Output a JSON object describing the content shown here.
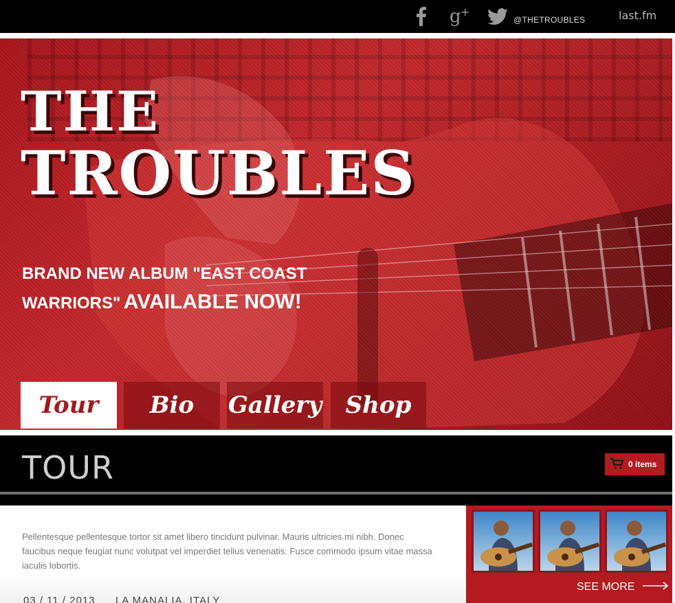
{
  "topbar": {
    "facebook_icon": "facebook-icon",
    "googleplus_icon": "google-plus-icon",
    "twitter_icon": "twitter-icon",
    "twitter_handle": "@THETROUBLES",
    "lastfm_label": "last.fm"
  },
  "hero": {
    "title_line1": "THE",
    "title_line2": "TROUBLES",
    "subtitle_part1": "BRAND NEW ALBUM \"EAST COAST",
    "subtitle_part2": "WARRIORS\"",
    "subtitle_part3": "AVAILABLE NOW!"
  },
  "nav": {
    "tabs": [
      {
        "label": "Tour",
        "active": true
      },
      {
        "label": "Bio",
        "active": false
      },
      {
        "label": "Gallery",
        "active": false
      },
      {
        "label": "Shop",
        "active": false
      }
    ]
  },
  "section": {
    "title": "TOUR",
    "cart_label": "0 items"
  },
  "content": {
    "paragraph": "Pellentesque pellentesque tortor sit amet libero tincidunt pulvinar. Mauris ultricies mi nibh. Donec faucibus neque feugiat nunc volutpat vel imperdiet tellus venenatis. Fusce commodo ipsum vitae massa iaculis lobortis.",
    "first_date": "03 / 11 / 2013",
    "first_city": "LA MANALIA, ITALY"
  },
  "gallery": {
    "see_more": "SEE MORE"
  },
  "colors": {
    "accent": "#b31b20",
    "topbar": "#000000",
    "section_title": "#cfcfcf"
  }
}
